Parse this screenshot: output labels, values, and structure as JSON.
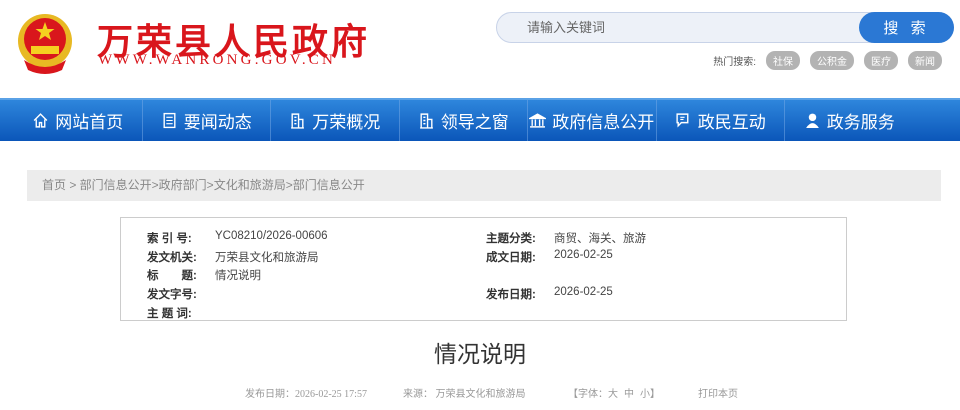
{
  "header": {
    "site_title": "万荣县人民政府",
    "site_url": "WWW.WANRONG.GOV.CN"
  },
  "search": {
    "placeholder": "请输入关键词",
    "button": "搜 索",
    "hot_label": "热门搜索:",
    "hot_tags": [
      "社保",
      "公积金",
      "医疗",
      "新闻"
    ]
  },
  "nav": [
    {
      "label": "网站首页",
      "icon": "home-icon"
    },
    {
      "label": "要闻动态",
      "icon": "document-icon"
    },
    {
      "label": "万荣概况",
      "icon": "building-icon"
    },
    {
      "label": "领导之窗",
      "icon": "building-icon"
    },
    {
      "label": "政府信息公开",
      "icon": "government-icon"
    },
    {
      "label": "政民互动",
      "icon": "chat-icon"
    },
    {
      "label": "政务服务",
      "icon": "user-icon"
    }
  ],
  "breadcrumb": "首页 > 部门信息公开>政府部门>文化和旅游局>部门信息公开",
  "info": {
    "index_label": "索 引 号:",
    "index": "YC08210/2026-00606",
    "topic_label": "主题分类:",
    "topic": "商贸、海关、旅游",
    "issuer_label": "发文机关:",
    "issuer": "万荣县文化和旅游局",
    "created_label": "成文日期:",
    "created": "2026-02-25",
    "title_label": "标　　题:",
    "title": "情况说明",
    "docno_label": "发文字号:",
    "published_label": "发布日期:",
    "published": "2026-02-25",
    "keywords_label": "主 题 词:"
  },
  "article": {
    "title": "情况说明",
    "date": "发布日期：2026-02-25 17:57",
    "source": "来源： 万荣县文化和旅游局",
    "font_label": "【字体：",
    "font_large": "大",
    "font_medium": "中",
    "font_small": "小",
    "font_close": "】",
    "print": "打印本页"
  }
}
